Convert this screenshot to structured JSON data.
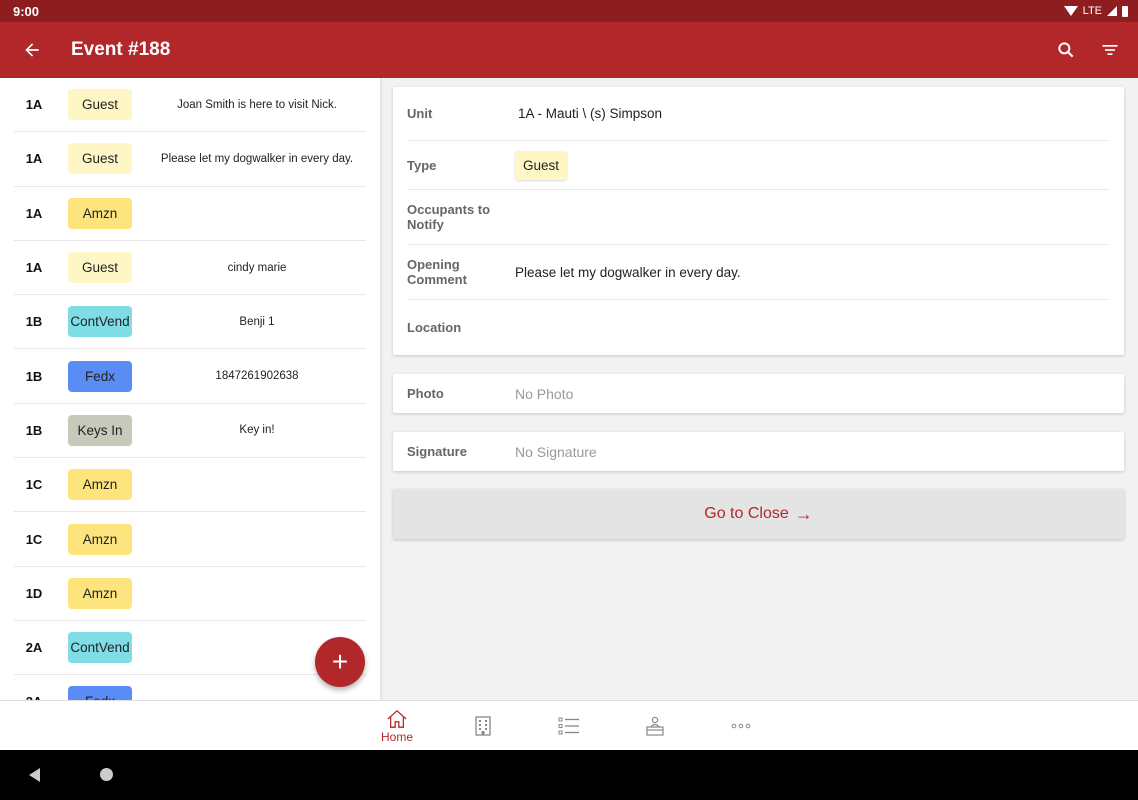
{
  "status_bar": {
    "time": "9:00",
    "network": "LTE"
  },
  "app_bar": {
    "title": "Event #188"
  },
  "events": [
    {
      "unit": "1A",
      "type": "Guest",
      "type_color": "#fef7c5",
      "note": "Joan Smith is here to visit Nick."
    },
    {
      "unit": "1A",
      "type": "Guest",
      "type_color": "#fef7c5",
      "note": "Please let my dogwalker in every day."
    },
    {
      "unit": "1A",
      "type": "Amzn",
      "type_color": "#fde47c",
      "note": ""
    },
    {
      "unit": "1A",
      "type": "Guest",
      "type_color": "#fef7c5",
      "note": "cindy marie"
    },
    {
      "unit": "1B",
      "type": "ContVend",
      "type_color": "#7fdde6",
      "note": "Benji 1"
    },
    {
      "unit": "1B",
      "type": "Fedx",
      "type_color": "#5a8cf5",
      "note": "1847261902638"
    },
    {
      "unit": "1B",
      "type": "Keys In",
      "type_color": "#c9c9bb",
      "note": "Key in!"
    },
    {
      "unit": "1C",
      "type": "Amzn",
      "type_color": "#fde47c",
      "note": ""
    },
    {
      "unit": "1C",
      "type": "Amzn",
      "type_color": "#fde47c",
      "note": ""
    },
    {
      "unit": "1D",
      "type": "Amzn",
      "type_color": "#fde47c",
      "note": ""
    },
    {
      "unit": "2A",
      "type": "ContVend",
      "type_color": "#7fdde6",
      "note": ""
    },
    {
      "unit": "2A",
      "type": "Fedx",
      "type_color": "#5a8cf5",
      "note": ""
    }
  ],
  "fab": {
    "label": "+"
  },
  "detail": {
    "unit_label": "Unit",
    "unit_value": "1A - Mauti \\ (s) Simpson",
    "type_label": "Type",
    "type_value": "Guest",
    "occupants_label": "Occupants to Notify",
    "comment_label": "Opening Comment",
    "comment_value": "Please let my dogwalker in every day.",
    "location_label": "Location"
  },
  "photo": {
    "label": "Photo",
    "placeholder": "No Photo"
  },
  "signature": {
    "label": "Signature",
    "placeholder": "No Signature"
  },
  "close_button": {
    "label": "Go to Close",
    "arrow": "→"
  },
  "bottom_nav": [
    {
      "icon": "home-icon",
      "label": "Home",
      "active": true
    },
    {
      "icon": "building-icon",
      "label": ""
    },
    {
      "icon": "list-icon",
      "label": ""
    },
    {
      "icon": "desk-person-icon",
      "label": ""
    },
    {
      "icon": "more-icon",
      "label": ""
    }
  ],
  "colors": {
    "primary": "#b1272a",
    "status_bar": "#8e1d1f"
  }
}
